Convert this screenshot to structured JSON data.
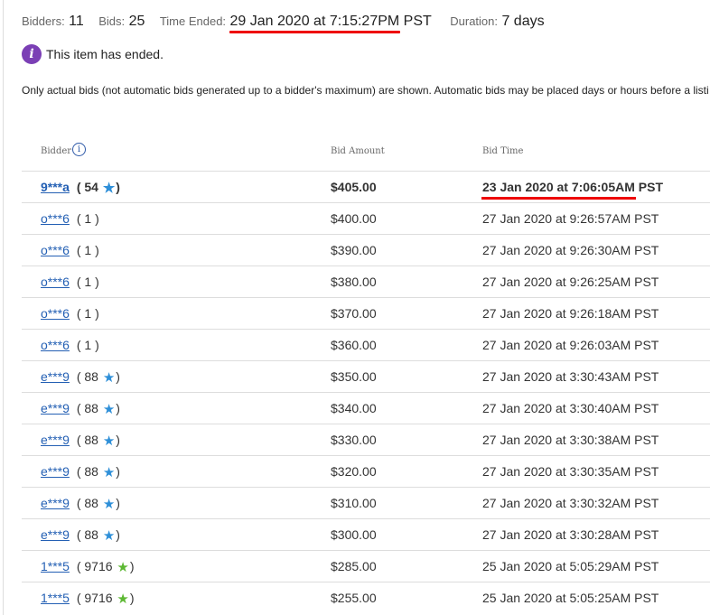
{
  "summary": {
    "bidders_label": "Bidders:",
    "bidders_value": "11",
    "bids_label": "Bids:",
    "bids_value": "25",
    "time_ended_label": "Time Ended:",
    "time_ended_value": "29 Jan 2020 at 7:15:27PM",
    "time_ended_tz": "PST",
    "duration_label": "Duration:",
    "duration_value": "7 days"
  },
  "status": {
    "icon": "info-icon",
    "icon_glyph": "i",
    "message": "This item has ended."
  },
  "note": "Only actual bids (not automatic bids generated up to a bidder's maximum) are shown. Automatic bids may be placed days or hours before a listi",
  "table": {
    "headers": {
      "bidder": "Bidder",
      "bidder_info_glyph": "i",
      "amount": "Bid Amount",
      "time": "Bid Time"
    },
    "rows": [
      {
        "bidder": "9***a",
        "fb_open": "(",
        "fb_count": "54",
        "fb_close": ")",
        "star": "blue",
        "amount": "$405.00",
        "time_main": "23 Jan 2020 at 7:06:05AM",
        "time_tz": "PST",
        "winner": true
      },
      {
        "bidder": "o***6",
        "fb_open": "(",
        "fb_count": "1",
        "fb_close": ")",
        "star": "",
        "amount": "$400.00",
        "time_main": "27 Jan 2020 at 9:26:57AM",
        "time_tz": "PST"
      },
      {
        "bidder": "o***6",
        "fb_open": "(",
        "fb_count": "1",
        "fb_close": ")",
        "star": "",
        "amount": "$390.00",
        "time_main": "27 Jan 2020 at 9:26:30AM",
        "time_tz": "PST"
      },
      {
        "bidder": "o***6",
        "fb_open": "(",
        "fb_count": "1",
        "fb_close": ")",
        "star": "",
        "amount": "$380.00",
        "time_main": "27 Jan 2020 at 9:26:25AM",
        "time_tz": "PST"
      },
      {
        "bidder": "o***6",
        "fb_open": "(",
        "fb_count": "1",
        "fb_close": ")",
        "star": "",
        "amount": "$370.00",
        "time_main": "27 Jan 2020 at 9:26:18AM",
        "time_tz": "PST"
      },
      {
        "bidder": "o***6",
        "fb_open": "(",
        "fb_count": "1",
        "fb_close": ")",
        "star": "",
        "amount": "$360.00",
        "time_main": "27 Jan 2020 at 9:26:03AM",
        "time_tz": "PST"
      },
      {
        "bidder": "e***9",
        "fb_open": "(",
        "fb_count": "88",
        "fb_close": ")",
        "star": "blue",
        "amount": "$350.00",
        "time_main": "27 Jan 2020 at 3:30:43AM",
        "time_tz": "PST"
      },
      {
        "bidder": "e***9",
        "fb_open": "(",
        "fb_count": "88",
        "fb_close": ")",
        "star": "blue",
        "amount": "$340.00",
        "time_main": "27 Jan 2020 at 3:30:40AM",
        "time_tz": "PST"
      },
      {
        "bidder": "e***9",
        "fb_open": "(",
        "fb_count": "88",
        "fb_close": ")",
        "star": "blue",
        "amount": "$330.00",
        "time_main": "27 Jan 2020 at 3:30:38AM",
        "time_tz": "PST"
      },
      {
        "bidder": "e***9",
        "fb_open": "(",
        "fb_count": "88",
        "fb_close": ")",
        "star": "blue",
        "amount": "$320.00",
        "time_main": "27 Jan 2020 at 3:30:35AM",
        "time_tz": "PST"
      },
      {
        "bidder": "e***9",
        "fb_open": "(",
        "fb_count": "88",
        "fb_close": ")",
        "star": "blue",
        "amount": "$310.00",
        "time_main": "27 Jan 2020 at 3:30:32AM",
        "time_tz": "PST"
      },
      {
        "bidder": "e***9",
        "fb_open": "(",
        "fb_count": "88",
        "fb_close": ")",
        "star": "blue",
        "amount": "$300.00",
        "time_main": "27 Jan 2020 at 3:30:28AM",
        "time_tz": "PST"
      },
      {
        "bidder": "1***5",
        "fb_open": "(",
        "fb_count": "9716",
        "fb_close": ")",
        "star": "green",
        "amount": "$285.00",
        "time_main": "25 Jan 2020 at 5:05:29AM",
        "time_tz": "PST"
      },
      {
        "bidder": "1***5",
        "fb_open": "(",
        "fb_count": "9716",
        "fb_close": ")",
        "star": "green",
        "amount": "$255.00",
        "time_main": "25 Jan 2020 at 5:05:25AM",
        "time_tz": "PST"
      }
    ]
  },
  "colors": {
    "link": "#2460b4",
    "info_icon_bg": "#7b3fb5",
    "highlight_underline": "#e00000",
    "star_blue": "#2e8fd8",
    "star_green": "#5cb832"
  }
}
